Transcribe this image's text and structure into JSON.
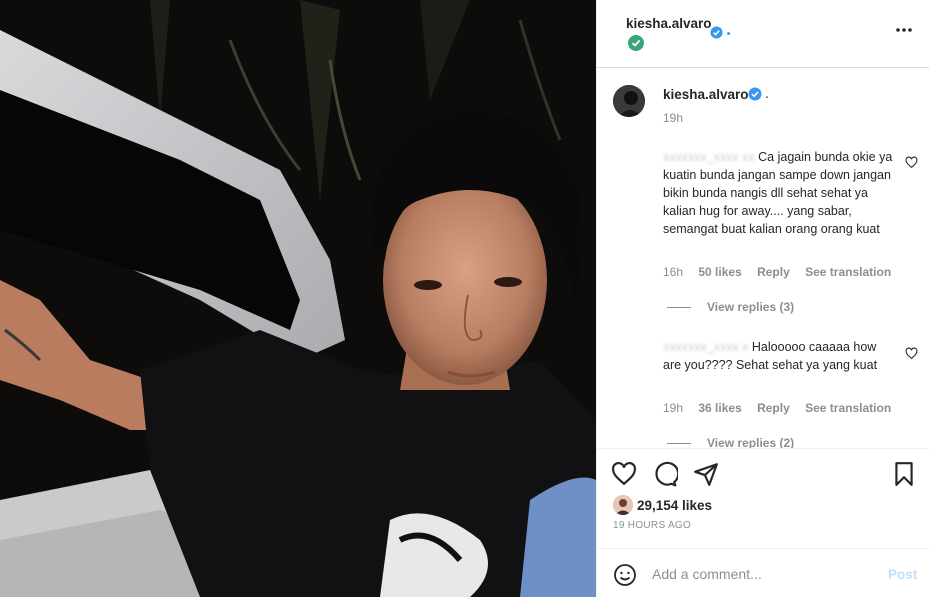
{
  "post": {
    "author": "kiesha.alvaro",
    "caption_text": ".",
    "caption_time": "19h",
    "likes": "29,154 likes",
    "time_ago": "19 HOURS AGO",
    "photo_description_icon": "photo"
  },
  "comments": [
    {
      "user": "",
      "text": "Ca jagain bunda okie ya kuatin bunda jangan sampe down jangan bikin bunda nangis dll sehat sehat ya kalian hug for away.... yang sabar, semangat buat kalian orang orang kuat",
      "time": "16h",
      "likes": "50 likes",
      "reply_label": "Reply",
      "translation_label": "See translation",
      "view_replies": "View replies (3)"
    },
    {
      "user": "",
      "text": "Halooooo caaaaa how are you???? Sehat sehat ya yang kuat",
      "time": "19h",
      "likes": "36 likes",
      "reply_label": "Reply",
      "translation_label": "See translation",
      "view_replies": "View replies (2)"
    }
  ],
  "add_comment": {
    "placeholder": "Add a comment...",
    "post_label": "Post"
  },
  "colors": {
    "verified": "#3897f0",
    "verified_green": "#3aa57a",
    "muted": "#8e8e8e",
    "post_disabled": "#c0dffd"
  },
  "icons": [
    "more-icon",
    "heart-icon",
    "comment-icon",
    "share-icon",
    "bookmark-icon",
    "emoji-icon",
    "verified-icon"
  ]
}
